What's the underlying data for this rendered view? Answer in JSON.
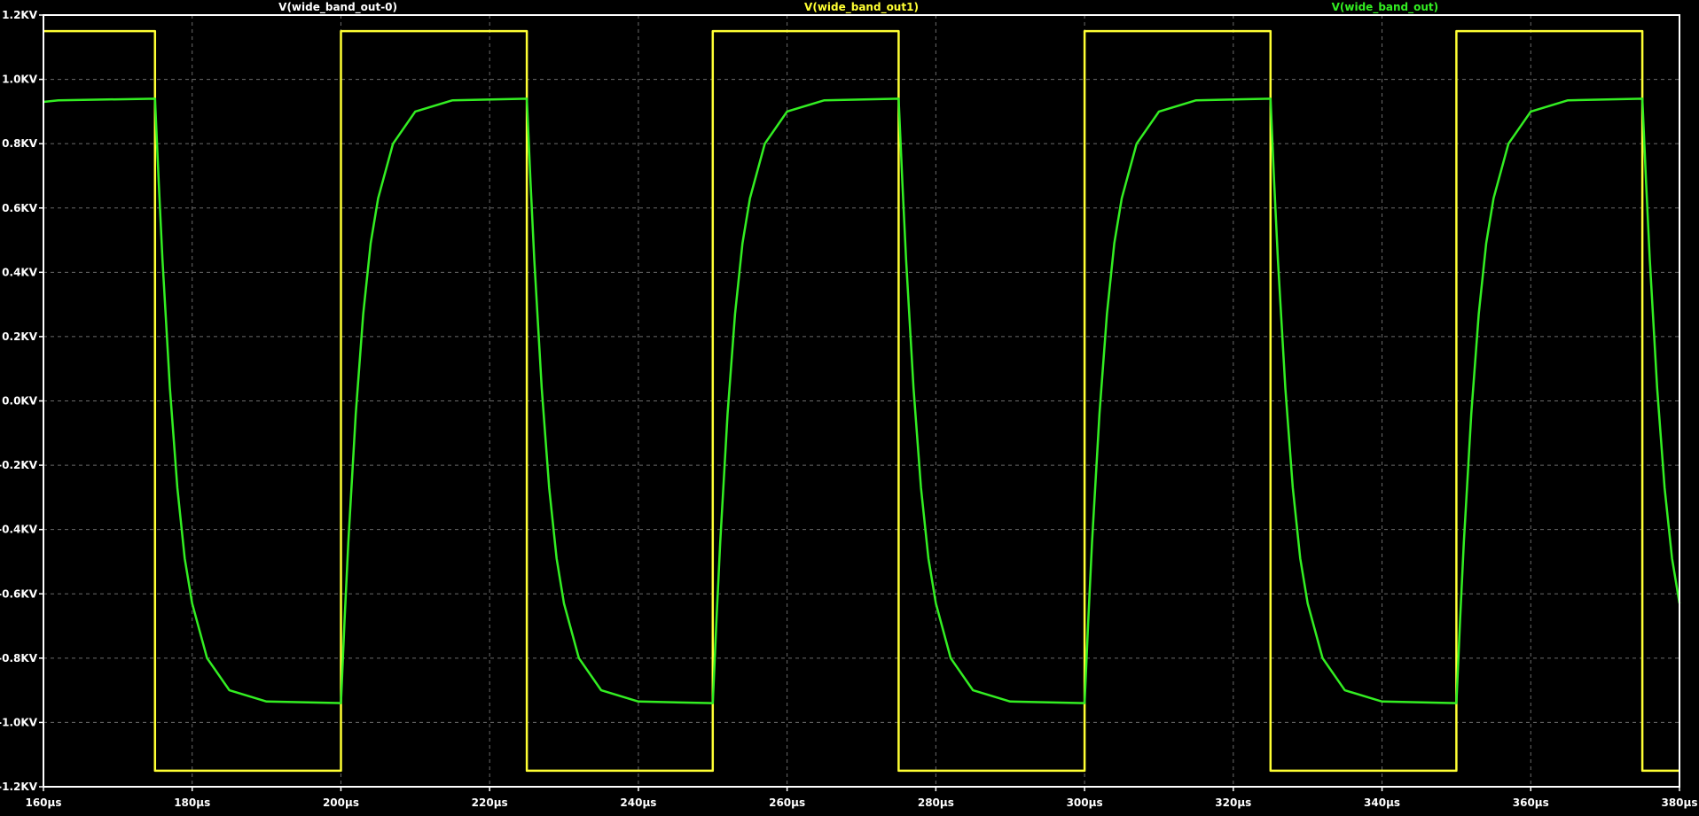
{
  "chart_data": {
    "type": "line",
    "title": "",
    "xlabel": "",
    "ylabel": "",
    "x_unit": "µs",
    "y_unit": "KV",
    "xlim": [
      160,
      380
    ],
    "ylim": [
      -1.2,
      1.2
    ],
    "grid": true,
    "background": "#000000",
    "frame_color": "#ffffff",
    "grid_color": "#6b6b6b",
    "x_ticks": [
      160,
      180,
      200,
      220,
      240,
      260,
      280,
      300,
      320,
      340,
      360,
      380
    ],
    "x_tick_labels": [
      "160µs",
      "180µs",
      "200µs",
      "220µs",
      "240µs",
      "260µs",
      "280µs",
      "300µs",
      "320µs",
      "340µs",
      "360µs",
      "380µs"
    ],
    "y_ticks": [
      1.2,
      1.0,
      0.8,
      0.6,
      0.4,
      0.2,
      0.0,
      -0.2,
      -0.4,
      -0.6,
      -0.8,
      -1.0,
      -1.2
    ],
    "y_tick_labels": [
      "1.2KV",
      "1.0KV",
      "0.8KV",
      "0.6KV",
      "0.4KV",
      "0.2KV",
      "0.0KV",
      "-0.2KV",
      "-0.4KV",
      "-0.6KV",
      "-0.8KV",
      "-1.0KV",
      "-1.2KV"
    ],
    "legend": [
      {
        "name": "V(wide_band_out-0)",
        "color": "#ffffff"
      },
      {
        "name": "V(wide_band_out1)",
        "color": "#ffff33"
      },
      {
        "name": "V(wide_band_out)",
        "color": "#33ee22"
      }
    ],
    "series": [
      {
        "name": "V(wide_band_out1)",
        "color": "#ffff33",
        "kind": "square",
        "high": 1.15,
        "low": -1.15,
        "start_level": "high",
        "transitions": [
          175,
          200,
          225,
          250,
          275,
          300,
          325,
          350,
          375
        ]
      },
      {
        "name": "V(wide_band_out)",
        "color": "#33ee22",
        "kind": "filtered-square",
        "high": 0.94,
        "low": -0.94,
        "x": [
          160,
          162,
          175,
          175.5,
          176,
          177,
          178,
          179,
          180,
          182,
          185,
          190,
          200,
          200.5,
          201,
          202,
          203,
          204,
          205,
          207,
          210,
          215,
          225,
          225.5,
          226,
          227,
          228,
          229,
          230,
          232,
          235,
          240,
          250,
          250.5,
          251,
          252,
          253,
          254,
          255,
          257,
          260,
          265,
          275,
          275.5,
          276,
          277,
          278,
          279,
          280,
          282,
          285,
          290,
          300,
          300.5,
          301,
          302,
          303,
          304,
          305,
          307,
          310,
          315,
          325,
          325.5,
          326,
          327,
          328,
          329,
          330,
          332,
          335,
          340,
          350,
          350.5,
          351,
          352,
          353,
          354,
          355,
          357,
          360,
          365,
          375,
          375.5,
          376,
          377,
          378,
          379,
          380
        ],
        "y": [
          0.93,
          0.935,
          0.94,
          0.68,
          0.44,
          0.04,
          -0.27,
          -0.49,
          -0.63,
          -0.8,
          -0.9,
          -0.935,
          -0.94,
          -0.68,
          -0.44,
          -0.04,
          0.27,
          0.49,
          0.63,
          0.8,
          0.9,
          0.935,
          0.94,
          0.68,
          0.44,
          0.04,
          -0.27,
          -0.49,
          -0.63,
          -0.8,
          -0.9,
          -0.935,
          -0.94,
          -0.68,
          -0.44,
          -0.04,
          0.27,
          0.49,
          0.63,
          0.8,
          0.9,
          0.935,
          0.94,
          0.68,
          0.44,
          0.04,
          -0.27,
          -0.49,
          -0.63,
          -0.8,
          -0.9,
          -0.935,
          -0.94,
          -0.68,
          -0.44,
          -0.04,
          0.27,
          0.49,
          0.63,
          0.8,
          0.9,
          0.935,
          0.94,
          0.68,
          0.44,
          0.04,
          -0.27,
          -0.49,
          -0.63,
          -0.8,
          -0.9,
          -0.935,
          -0.94,
          -0.68,
          -0.44,
          -0.04,
          0.27,
          0.49,
          0.63,
          0.8,
          0.9,
          0.935,
          0.94,
          0.68,
          0.44,
          0.04,
          -0.27,
          -0.49,
          -0.63
        ]
      }
    ]
  }
}
